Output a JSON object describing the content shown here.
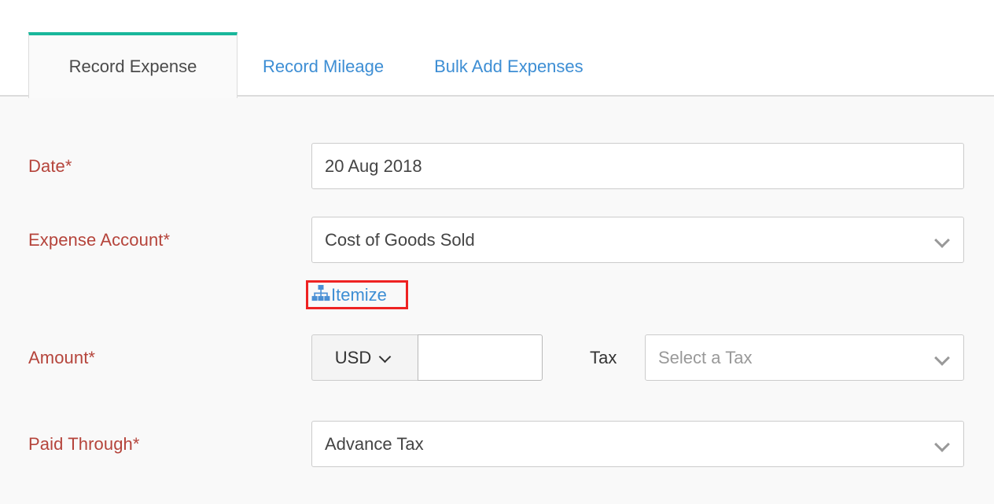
{
  "tabs": [
    {
      "label": "Record Expense",
      "active": true
    },
    {
      "label": "Record Mileage",
      "active": false
    },
    {
      "label": "Bulk Add Expenses",
      "active": false
    }
  ],
  "tab_labels": {
    "record_expense": "Record Expense",
    "record_mileage": "Record Mileage",
    "bulk_add_expenses": "Bulk Add Expenses"
  },
  "form": {
    "date": {
      "label": "Date*",
      "value": "20 Aug 2018"
    },
    "expense_account": {
      "label": "Expense Account*",
      "value": "Cost of Goods Sold"
    },
    "itemize": {
      "label": "Itemize",
      "icon": "sitemap-icon"
    },
    "amount": {
      "label": "Amount*",
      "currency": "USD",
      "value": "",
      "placeholder": ""
    },
    "tax": {
      "label": "Tax",
      "value": "",
      "placeholder": "Select a Tax"
    },
    "paid_through": {
      "label": "Paid Through*",
      "value": "Advance Tax"
    }
  },
  "colors": {
    "accent_teal": "#19b79b",
    "link_blue": "#3d8ed4",
    "required_label_red": "#b5443b",
    "highlight_red": "#ee2222",
    "field_border": "#cccccc",
    "page_background": "#f9f9f9"
  }
}
